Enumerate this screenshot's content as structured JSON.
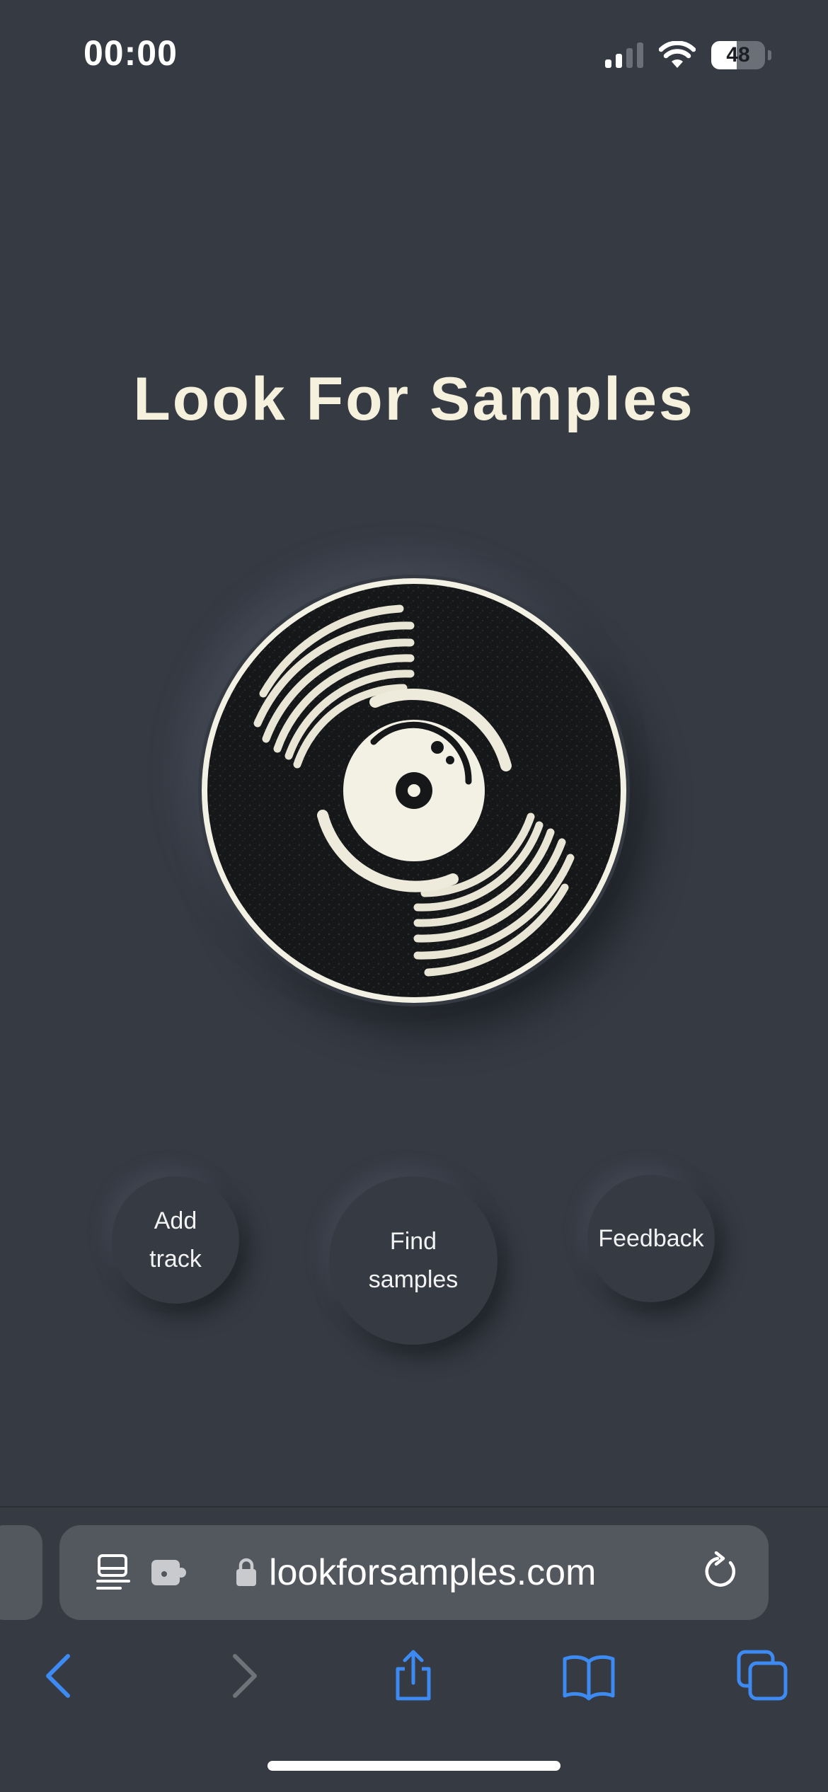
{
  "status_bar": {
    "time": "00:00",
    "battery_percent": "48",
    "battery_level": 0.48,
    "signal_bars_active": 2,
    "signal_bars_total": 4,
    "icons": [
      "cellular-signal-icon",
      "wifi-icon",
      "battery-icon"
    ]
  },
  "main": {
    "title": "Look For Samples",
    "logo": "vinyl-record-icon",
    "buttons": {
      "add_track": "Add\ntrack",
      "find_samples": "Find\nsamples",
      "feedback": "Feedback"
    }
  },
  "browser": {
    "url": "lookforsamples.com",
    "address_icons": [
      "reader-icon",
      "extension-icon",
      "lock-icon",
      "reload-icon"
    ],
    "toolbar_icons": [
      "back-icon",
      "forward-icon",
      "share-icon",
      "bookmarks-icon",
      "tabs-icon"
    ]
  },
  "colors": {
    "background": "#353a43",
    "title": "#f6f1dd",
    "record_cream": "#f3f1e4",
    "record_black": "#121416",
    "browser_field": "#53575e",
    "accent_blue": "#3d8bf2"
  }
}
